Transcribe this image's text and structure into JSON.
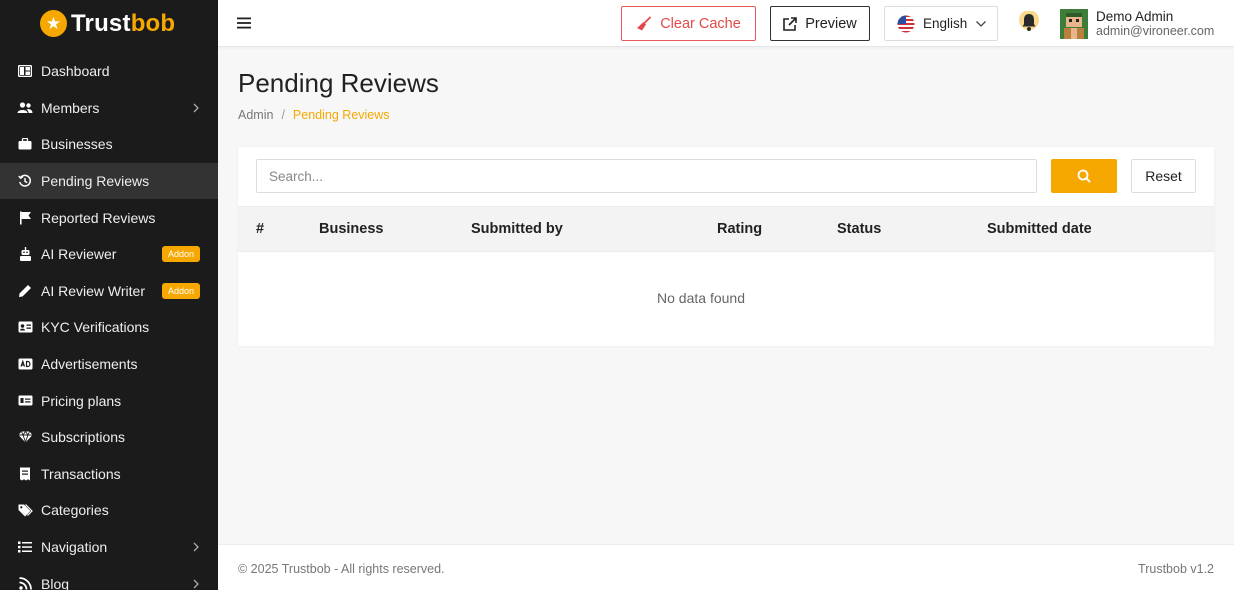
{
  "brand": {
    "prefix": "Trust",
    "suffix": "bob"
  },
  "sidebar": {
    "items": [
      {
        "label": "Dashboard"
      },
      {
        "label": "Members"
      },
      {
        "label": "Businesses"
      },
      {
        "label": "Pending Reviews"
      },
      {
        "label": "Reported Reviews"
      },
      {
        "label": "AI Reviewer",
        "badge": "Addon"
      },
      {
        "label": "AI Review Writer",
        "badge": "Addon"
      },
      {
        "label": "KYC Verifications"
      },
      {
        "label": "Advertisements"
      },
      {
        "label": "Pricing plans"
      },
      {
        "label": "Subscriptions"
      },
      {
        "label": "Transactions"
      },
      {
        "label": "Categories"
      },
      {
        "label": "Navigation"
      },
      {
        "label": "Blog"
      }
    ]
  },
  "header": {
    "clear_cache": "Clear Cache",
    "preview": "Preview",
    "language": "English",
    "user_name": "Demo Admin",
    "user_email": "admin@vironeer.com"
  },
  "page": {
    "title": "Pending Reviews",
    "breadcrumb_root": "Admin",
    "breadcrumb_current": "Pending Reviews"
  },
  "search": {
    "placeholder": "Search...",
    "reset": "Reset"
  },
  "table": {
    "columns": [
      "#",
      "Business",
      "Submitted by",
      "Rating",
      "Status",
      "Submitted date"
    ],
    "empty_text": "No data found"
  },
  "footer": {
    "copyright": "© 2025 Trustbob - All rights reserved.",
    "version": "Trustbob v1.2"
  },
  "colors": {
    "accent": "#f6a800",
    "sidebar_bg": "#1b1b1b",
    "danger": "#e24a4a"
  }
}
